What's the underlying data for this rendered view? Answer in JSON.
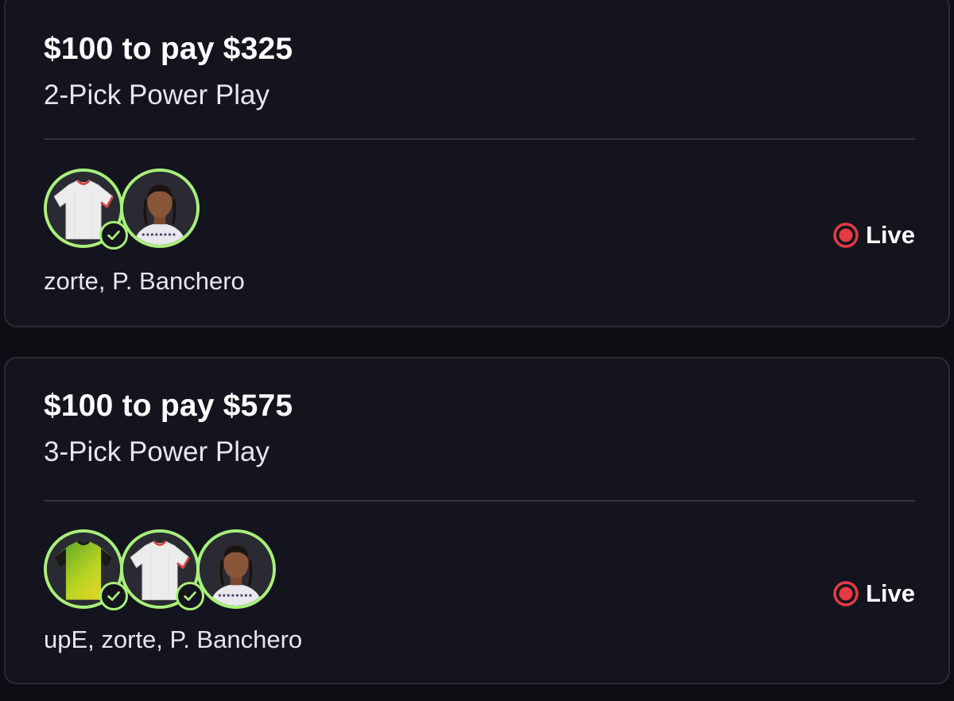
{
  "colors": {
    "background": "#0d0d14",
    "card": "#14141e",
    "card_border": "#2b2b36",
    "pick_ring": "#a7f07a",
    "live_red": "#e53b43",
    "text_primary": "#ffffff",
    "text_secondary": "#e6e6ec"
  },
  "entries": [
    {
      "title": "$100 to pay $325",
      "subtitle": "2-Pick Power Play",
      "players_text": "zorte, P. Banchero",
      "status_label": "Live",
      "picks": [
        {
          "avatar_icon": "white-jersey-icon",
          "hit": true
        },
        {
          "avatar_icon": "player-headshot-icon",
          "hit": false
        }
      ]
    },
    {
      "title": "$100 to pay $575",
      "subtitle": "3-Pick Power Play",
      "players_text": "upE, zorte, P. Banchero",
      "status_label": "Live",
      "picks": [
        {
          "avatar_icon": "green-yellow-jersey-icon",
          "hit": true
        },
        {
          "avatar_icon": "white-jersey-icon",
          "hit": true
        },
        {
          "avatar_icon": "player-headshot-icon",
          "hit": false
        }
      ]
    }
  ]
}
